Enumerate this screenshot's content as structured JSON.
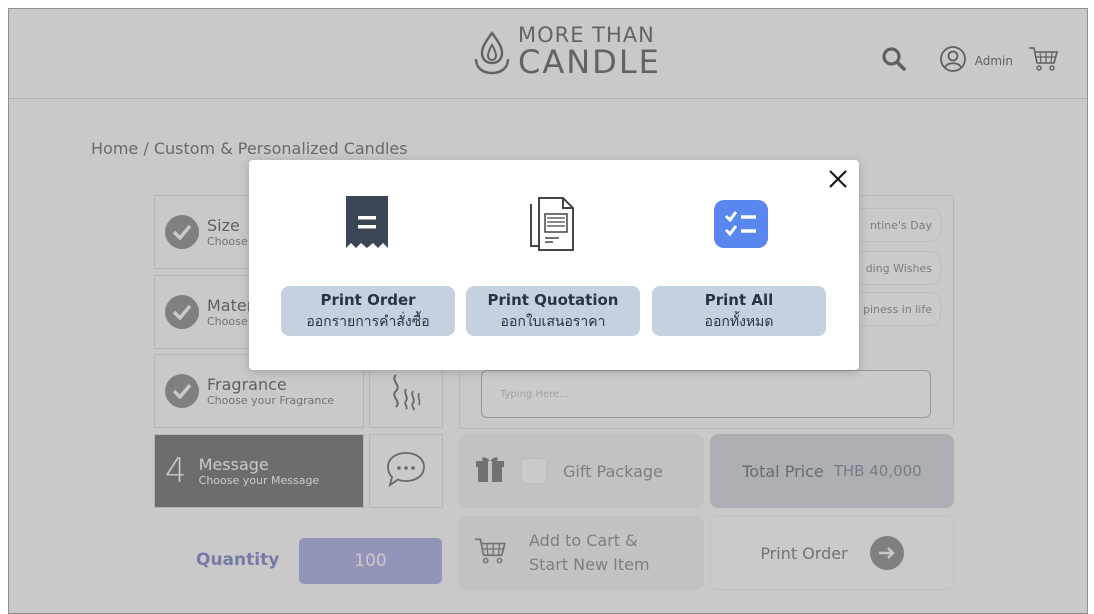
{
  "header": {
    "logo_top": "MORE THAN",
    "logo_bottom": "CANDLE",
    "user_label": "Admin"
  },
  "breadcrumb": "Home / Custom & Personalized Candles",
  "steps": [
    {
      "title": "Size",
      "sub": "Choose",
      "state": "done"
    },
    {
      "title": "Mater",
      "sub": "Choose",
      "state": "done"
    },
    {
      "title": "Fragrance",
      "sub": "Choose your Fragrance",
      "state": "done"
    },
    {
      "number": "4",
      "title": "Message",
      "sub": "Choose your Message",
      "state": "active"
    }
  ],
  "occasion_chips": [
    "ntine's Day",
    "ding Wishes",
    "piness in life"
  ],
  "message_placeholder": "Typing Here...",
  "gift_package_label": "Gift Package",
  "total": {
    "label": "Total Price",
    "value": "THB 40,000"
  },
  "quantity": {
    "label": "Quantity",
    "value": "100"
  },
  "add_to_cart": {
    "line1": "Add to Cart &",
    "line2": "Start New Item"
  },
  "print_order_bottom": "Print Order",
  "modal": {
    "options": [
      {
        "en": "Print Order",
        "th": "ออกรายการคำสั่งซื้อ",
        "icon": "receipt-icon"
      },
      {
        "en": "Print Quotation",
        "th": "ออกใบเสนอราคา",
        "icon": "document-icon"
      },
      {
        "en": "Print All",
        "th": "ออกทั้งหมด",
        "icon": "checklist-icon"
      }
    ]
  },
  "colors": {
    "accent_blue": "#5a86f0",
    "option_button": "#c5d1de",
    "quantity_box": "#9094d4",
    "active_step": "#4c4c4c"
  }
}
